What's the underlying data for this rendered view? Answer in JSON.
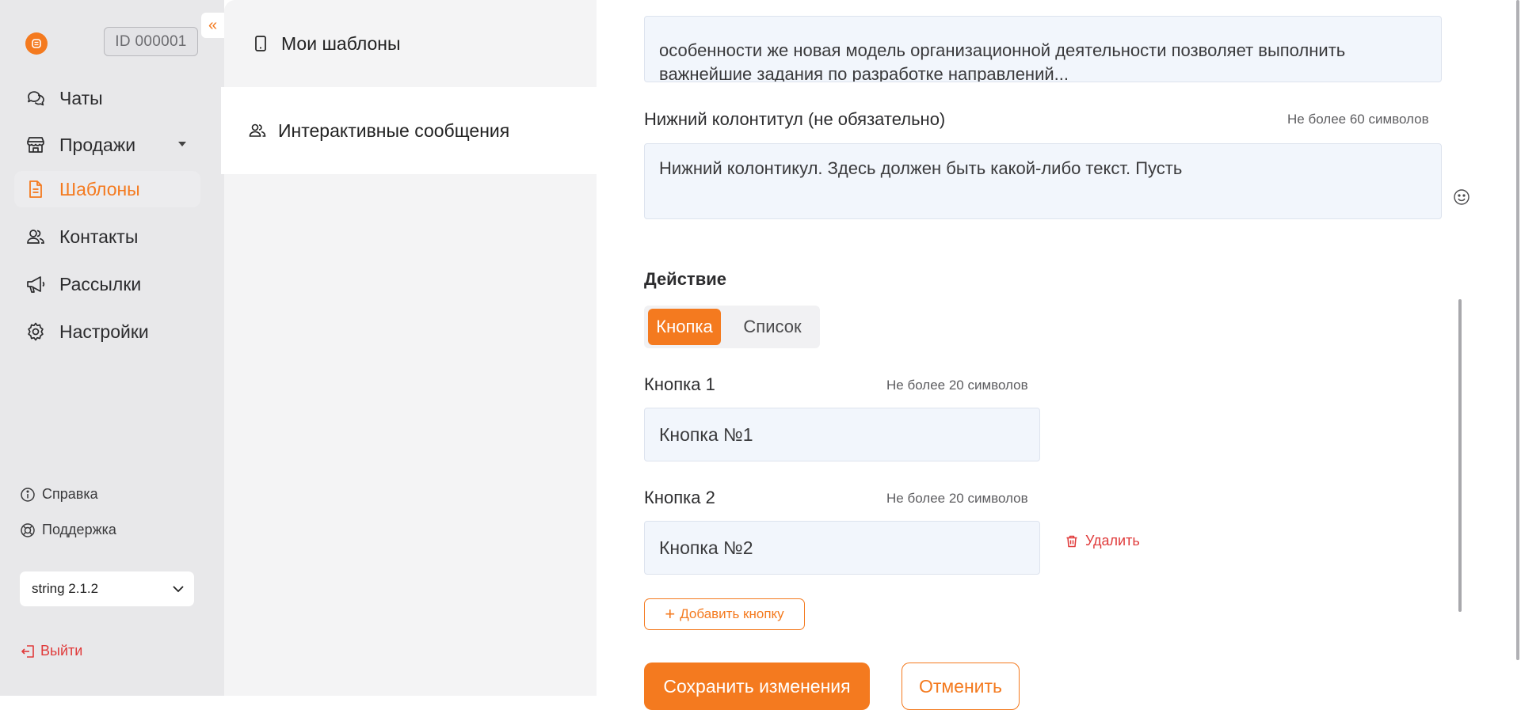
{
  "sidebar": {
    "account_id": "ID 000001",
    "collapse_icon": "«",
    "nav": [
      {
        "label": "Чаты",
        "icon": "chat-icon"
      },
      {
        "label": "Продажи",
        "icon": "store-icon"
      },
      {
        "label": "Шаблоны",
        "icon": "document-icon",
        "active": true
      },
      {
        "label": "Контакты",
        "icon": "users-icon"
      },
      {
        "label": "Рассылки",
        "icon": "megaphone-icon"
      },
      {
        "label": "Настройки",
        "icon": "gear-icon"
      }
    ],
    "help_label": "Справка",
    "support_label": "Поддержка",
    "version_value": "string 2.1.2",
    "logout_label": "Выйти"
  },
  "templates_menu": {
    "items": [
      {
        "label": "Мои шаблоны",
        "icon": "phone-icon"
      },
      {
        "label": "Интерактивные сообщения",
        "icon": "users-icon",
        "active": true
      }
    ]
  },
  "form": {
    "body_text_line1": "особенности же новая модель организационной деятельности позволяет выполнить",
    "body_text_line2": "важнейшие задания по разработке направлений...",
    "footer_label": "Нижний колонтитул (не обязательно)",
    "footer_hint": "Не более 60 символов",
    "footer_value": "Нижний колонтикул. Здесь должен быть какой-либо текст. Пусть",
    "action_heading": "Действие",
    "action_tabs": [
      "Кнопка",
      "Список"
    ],
    "buttons": [
      {
        "label": "Кнопка 1",
        "hint": "Не более 20 символов",
        "value": "Кнопка №1"
      },
      {
        "label": "Кнопка 2",
        "hint": "Не более 20 символов",
        "value": "Кнопка №2"
      }
    ],
    "delete_label": "Удалить",
    "add_button_label": "Добавить кнопку",
    "save_label": "Сохранить изменения",
    "cancel_label": "Отменить"
  },
  "colors": {
    "accent": "#f47a1f",
    "danger": "#e03a3a",
    "sidebar_bg": "#e8e8ea",
    "field_bg": "#f2f6fc"
  }
}
